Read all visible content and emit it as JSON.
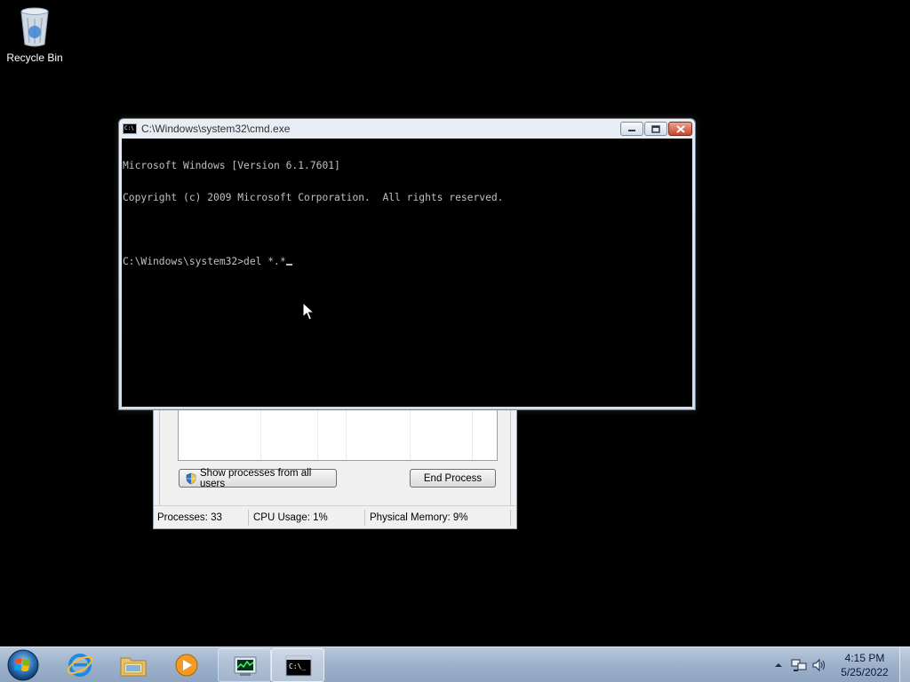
{
  "desktop": {
    "icons": [
      {
        "label": "Recycle Bin",
        "icon": "recycle-bin-icon"
      }
    ]
  },
  "taskmgr": {
    "show_processes_label": "Show processes from all users",
    "end_process_label": "End Process",
    "status": {
      "processes": "Processes: 33",
      "cpu": "CPU Usage: 1%",
      "memory": "Physical Memory: 9%"
    }
  },
  "cmd": {
    "title": "C:\\Windows\\system32\\cmd.exe",
    "lines": [
      "Microsoft Windows [Version 6.1.7601]",
      "Copyright (c) 2009 Microsoft Corporation.  All rights reserved.",
      "",
      "C:\\Windows\\system32>del *.*"
    ]
  },
  "taskbar": {
    "pinned": [
      {
        "icon": "internet-explorer-icon"
      },
      {
        "icon": "windows-explorer-icon"
      },
      {
        "icon": "media-player-icon"
      },
      {
        "icon": "task-manager-icon"
      },
      {
        "icon": "command-prompt-icon"
      }
    ],
    "clock": {
      "time": "4:15 PM",
      "date": "5/25/2022"
    }
  },
  "colors": {
    "console_bg": "#000000",
    "console_fg": "#c0c0c0",
    "taskbar": "#9fb3cc",
    "close_button": "#c8452b"
  }
}
